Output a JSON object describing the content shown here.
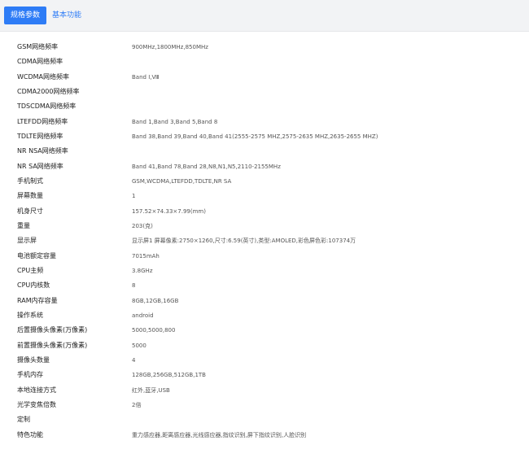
{
  "tabs": {
    "active": "规格参数",
    "inactive": "基本功能"
  },
  "specs": [
    {
      "label": "GSM网络频率",
      "value": "900MHz,1800MHz,850MHz"
    },
    {
      "label": "CDMA网络频率",
      "value": ""
    },
    {
      "label": "WCDMA网络频率",
      "value": "Band Ⅰ,Ⅷ"
    },
    {
      "label": "CDMA2000网络频率",
      "value": ""
    },
    {
      "label": "TDSCDMA网络频率",
      "value": ""
    },
    {
      "label": "LTEFDD网络频率",
      "value": "Band 1,Band 3,Band 5,Band 8"
    },
    {
      "label": "TDLTE网络频率",
      "value": "Band 38,Band 39,Band 40,Band 41(2555-2575 MHZ,2575-2635 MHZ,2635-2655 MHZ)"
    },
    {
      "label": "NR NSA网络频率",
      "value": ""
    },
    {
      "label": "NR SA网络频率",
      "value": "Band 41,Band 78,Band 28,N8,N1,N5,2110-2155MHz"
    },
    {
      "label": "手机制式",
      "value": "GSM,WCDMA,LTEFDD,TDLTE,NR SA"
    },
    {
      "label": "屏幕数量",
      "value": "1"
    },
    {
      "label": "机身尺寸",
      "value": "157.52×74.33×7.99(mm)"
    },
    {
      "label": "重量",
      "value": "203(克)"
    },
    {
      "label": "显示屏",
      "value": "显示屏1 屏幕像素:2750×1260,尺寸:6.59(英寸),类型:AMOLED,彩色屏色彩:107374万"
    },
    {
      "label": "电池额定容量",
      "value": "7015mAh"
    },
    {
      "label": "CPU主频",
      "value": "3.8GHz"
    },
    {
      "label": "CPU内核数",
      "value": "8"
    },
    {
      "label": "RAM内存容量",
      "value": "8GB,12GB,16GB"
    },
    {
      "label": "操作系统",
      "value": "android"
    },
    {
      "label": "后置摄像头像素(万像素)",
      "value": "5000,5000,800"
    },
    {
      "label": "前置摄像头像素(万像素)",
      "value": "5000"
    },
    {
      "label": "摄像头数量",
      "value": "4"
    },
    {
      "label": "手机内存",
      "value": "128GB,256GB,512GB,1TB"
    },
    {
      "label": "本地连接方式",
      "value": "红外,蓝牙,USB"
    },
    {
      "label": "光学变焦倍数",
      "value": "2倍"
    },
    {
      "label": "定制",
      "value": ""
    },
    {
      "label": "特色功能",
      "value": "重力感应器,距离感应器,光线感应器,指纹识别,屏下指纹识别,人脸识别"
    }
  ]
}
